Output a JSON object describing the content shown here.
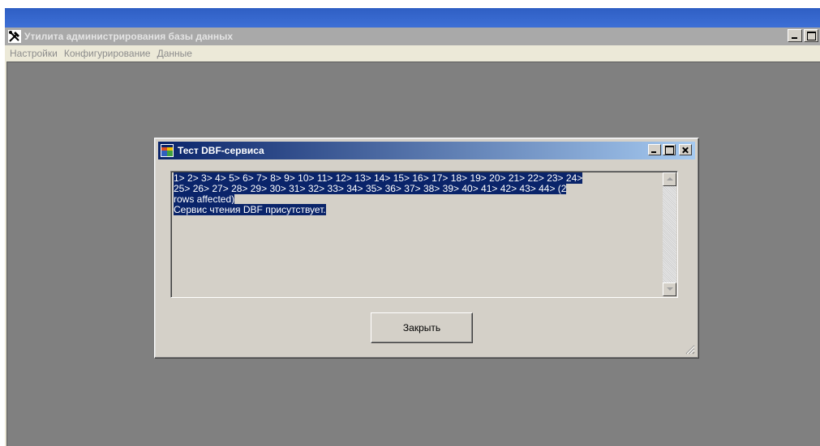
{
  "main_window": {
    "title": "Утилита администрирования базы данных",
    "app_icon": "tools-icon"
  },
  "menu": {
    "items": [
      "Настройки",
      "Конфигурирование",
      "Данные"
    ]
  },
  "dialog": {
    "title": "Тест DBF-сервиса",
    "icon": "window-app-icon",
    "output_lines": [
      "1> 2> 3> 4> 5> 6> 7> 8> 9> 10> 11> 12> 13> 14> 15> 16> 17> 18> 19> 20> 21> 22> 23> 24>",
      "25> 26> 27> 28> 29> 30> 31> 32> 33> 34> 35> 36> 37> 38> 39> 40> 41> 42> 43> 44> (2",
      "rows affected)",
      "Сервис чтения DBF присутствует."
    ],
    "close_button_label": "Закрыть"
  },
  "colors": {
    "desktop_bar": "#3d6fd6",
    "selection": "#0a246a",
    "mdi_background": "#808080",
    "dialog_face": "#d4d0c8"
  }
}
